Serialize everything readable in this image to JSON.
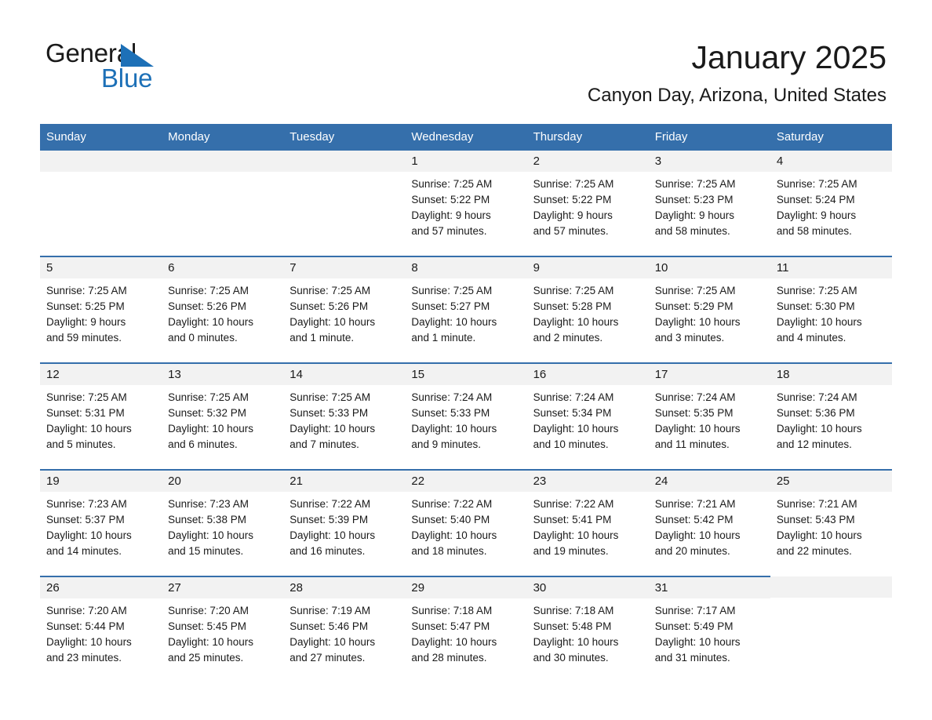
{
  "brand": {
    "logo_text_1": "General",
    "logo_text_2": "Blue",
    "logo_triangle_icon": "triangle-icon",
    "accent_color": "#1d70b7",
    "header_color": "#356fab"
  },
  "header": {
    "title": "January 2025",
    "subtitle": "Canyon Day, Arizona, United States"
  },
  "calendar": {
    "weekday_headers": [
      "Sunday",
      "Monday",
      "Tuesday",
      "Wednesday",
      "Thursday",
      "Friday",
      "Saturday"
    ],
    "weeks": [
      [
        {
          "day": "",
          "sunrise": "",
          "sunset": "",
          "daylight_line1": "",
          "daylight_line2": ""
        },
        {
          "day": "",
          "sunrise": "",
          "sunset": "",
          "daylight_line1": "",
          "daylight_line2": ""
        },
        {
          "day": "",
          "sunrise": "",
          "sunset": "",
          "daylight_line1": "",
          "daylight_line2": ""
        },
        {
          "day": "1",
          "sunrise": "Sunrise: 7:25 AM",
          "sunset": "Sunset: 5:22 PM",
          "daylight_line1": "Daylight: 9 hours",
          "daylight_line2": "and 57 minutes."
        },
        {
          "day": "2",
          "sunrise": "Sunrise: 7:25 AM",
          "sunset": "Sunset: 5:22 PM",
          "daylight_line1": "Daylight: 9 hours",
          "daylight_line2": "and 57 minutes."
        },
        {
          "day": "3",
          "sunrise": "Sunrise: 7:25 AM",
          "sunset": "Sunset: 5:23 PM",
          "daylight_line1": "Daylight: 9 hours",
          "daylight_line2": "and 58 minutes."
        },
        {
          "day": "4",
          "sunrise": "Sunrise: 7:25 AM",
          "sunset": "Sunset: 5:24 PM",
          "daylight_line1": "Daylight: 9 hours",
          "daylight_line2": "and 58 minutes."
        }
      ],
      [
        {
          "day": "5",
          "sunrise": "Sunrise: 7:25 AM",
          "sunset": "Sunset: 5:25 PM",
          "daylight_line1": "Daylight: 9 hours",
          "daylight_line2": "and 59 minutes."
        },
        {
          "day": "6",
          "sunrise": "Sunrise: 7:25 AM",
          "sunset": "Sunset: 5:26 PM",
          "daylight_line1": "Daylight: 10 hours",
          "daylight_line2": "and 0 minutes."
        },
        {
          "day": "7",
          "sunrise": "Sunrise: 7:25 AM",
          "sunset": "Sunset: 5:26 PM",
          "daylight_line1": "Daylight: 10 hours",
          "daylight_line2": "and 1 minute."
        },
        {
          "day": "8",
          "sunrise": "Sunrise: 7:25 AM",
          "sunset": "Sunset: 5:27 PM",
          "daylight_line1": "Daylight: 10 hours",
          "daylight_line2": "and 1 minute."
        },
        {
          "day": "9",
          "sunrise": "Sunrise: 7:25 AM",
          "sunset": "Sunset: 5:28 PM",
          "daylight_line1": "Daylight: 10 hours",
          "daylight_line2": "and 2 minutes."
        },
        {
          "day": "10",
          "sunrise": "Sunrise: 7:25 AM",
          "sunset": "Sunset: 5:29 PM",
          "daylight_line1": "Daylight: 10 hours",
          "daylight_line2": "and 3 minutes."
        },
        {
          "day": "11",
          "sunrise": "Sunrise: 7:25 AM",
          "sunset": "Sunset: 5:30 PM",
          "daylight_line1": "Daylight: 10 hours",
          "daylight_line2": "and 4 minutes."
        }
      ],
      [
        {
          "day": "12",
          "sunrise": "Sunrise: 7:25 AM",
          "sunset": "Sunset: 5:31 PM",
          "daylight_line1": "Daylight: 10 hours",
          "daylight_line2": "and 5 minutes."
        },
        {
          "day": "13",
          "sunrise": "Sunrise: 7:25 AM",
          "sunset": "Sunset: 5:32 PM",
          "daylight_line1": "Daylight: 10 hours",
          "daylight_line2": "and 6 minutes."
        },
        {
          "day": "14",
          "sunrise": "Sunrise: 7:25 AM",
          "sunset": "Sunset: 5:33 PM",
          "daylight_line1": "Daylight: 10 hours",
          "daylight_line2": "and 7 minutes."
        },
        {
          "day": "15",
          "sunrise": "Sunrise: 7:24 AM",
          "sunset": "Sunset: 5:33 PM",
          "daylight_line1": "Daylight: 10 hours",
          "daylight_line2": "and 9 minutes."
        },
        {
          "day": "16",
          "sunrise": "Sunrise: 7:24 AM",
          "sunset": "Sunset: 5:34 PM",
          "daylight_line1": "Daylight: 10 hours",
          "daylight_line2": "and 10 minutes."
        },
        {
          "day": "17",
          "sunrise": "Sunrise: 7:24 AM",
          "sunset": "Sunset: 5:35 PM",
          "daylight_line1": "Daylight: 10 hours",
          "daylight_line2": "and 11 minutes."
        },
        {
          "day": "18",
          "sunrise": "Sunrise: 7:24 AM",
          "sunset": "Sunset: 5:36 PM",
          "daylight_line1": "Daylight: 10 hours",
          "daylight_line2": "and 12 minutes."
        }
      ],
      [
        {
          "day": "19",
          "sunrise": "Sunrise: 7:23 AM",
          "sunset": "Sunset: 5:37 PM",
          "daylight_line1": "Daylight: 10 hours",
          "daylight_line2": "and 14 minutes."
        },
        {
          "day": "20",
          "sunrise": "Sunrise: 7:23 AM",
          "sunset": "Sunset: 5:38 PM",
          "daylight_line1": "Daylight: 10 hours",
          "daylight_line2": "and 15 minutes."
        },
        {
          "day": "21",
          "sunrise": "Sunrise: 7:22 AM",
          "sunset": "Sunset: 5:39 PM",
          "daylight_line1": "Daylight: 10 hours",
          "daylight_line2": "and 16 minutes."
        },
        {
          "day": "22",
          "sunrise": "Sunrise: 7:22 AM",
          "sunset": "Sunset: 5:40 PM",
          "daylight_line1": "Daylight: 10 hours",
          "daylight_line2": "and 18 minutes."
        },
        {
          "day": "23",
          "sunrise": "Sunrise: 7:22 AM",
          "sunset": "Sunset: 5:41 PM",
          "daylight_line1": "Daylight: 10 hours",
          "daylight_line2": "and 19 minutes."
        },
        {
          "day": "24",
          "sunrise": "Sunrise: 7:21 AM",
          "sunset": "Sunset: 5:42 PM",
          "daylight_line1": "Daylight: 10 hours",
          "daylight_line2": "and 20 minutes."
        },
        {
          "day": "25",
          "sunrise": "Sunrise: 7:21 AM",
          "sunset": "Sunset: 5:43 PM",
          "daylight_line1": "Daylight: 10 hours",
          "daylight_line2": "and 22 minutes."
        }
      ],
      [
        {
          "day": "26",
          "sunrise": "Sunrise: 7:20 AM",
          "sunset": "Sunset: 5:44 PM",
          "daylight_line1": "Daylight: 10 hours",
          "daylight_line2": "and 23 minutes."
        },
        {
          "day": "27",
          "sunrise": "Sunrise: 7:20 AM",
          "sunset": "Sunset: 5:45 PM",
          "daylight_line1": "Daylight: 10 hours",
          "daylight_line2": "and 25 minutes."
        },
        {
          "day": "28",
          "sunrise": "Sunrise: 7:19 AM",
          "sunset": "Sunset: 5:46 PM",
          "daylight_line1": "Daylight: 10 hours",
          "daylight_line2": "and 27 minutes."
        },
        {
          "day": "29",
          "sunrise": "Sunrise: 7:18 AM",
          "sunset": "Sunset: 5:47 PM",
          "daylight_line1": "Daylight: 10 hours",
          "daylight_line2": "and 28 minutes."
        },
        {
          "day": "30",
          "sunrise": "Sunrise: 7:18 AM",
          "sunset": "Sunset: 5:48 PM",
          "daylight_line1": "Daylight: 10 hours",
          "daylight_line2": "and 30 minutes."
        },
        {
          "day": "31",
          "sunrise": "Sunrise: 7:17 AM",
          "sunset": "Sunset: 5:49 PM",
          "daylight_line1": "Daylight: 10 hours",
          "daylight_line2": "and 31 minutes."
        },
        {
          "day": "",
          "sunrise": "",
          "sunset": "",
          "daylight_line1": "",
          "daylight_line2": ""
        }
      ]
    ]
  }
}
